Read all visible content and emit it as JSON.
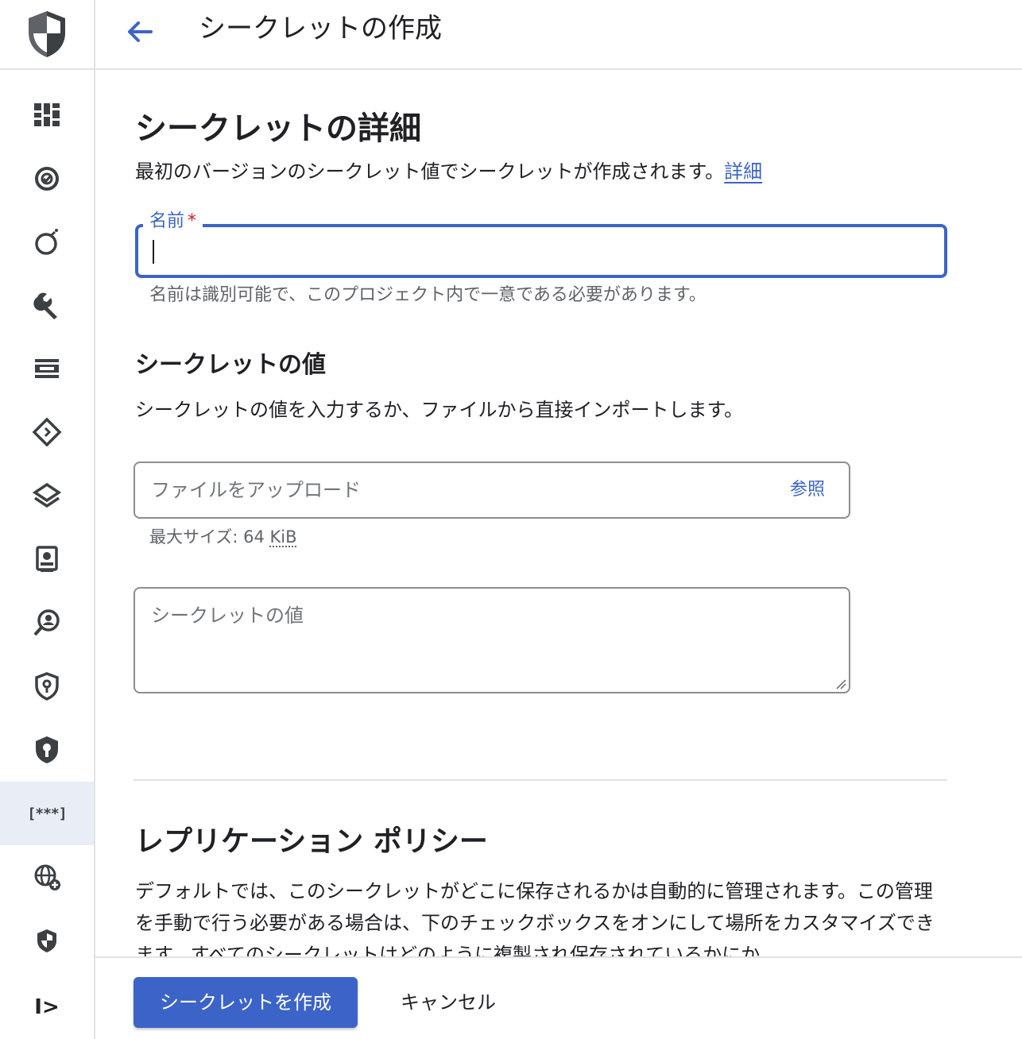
{
  "header": {
    "title": "シークレットの作成"
  },
  "sidebar": {
    "items": [
      {
        "icon": "dashboard-icon"
      },
      {
        "icon": "threat-detection-icon"
      },
      {
        "icon": "bomb-icon"
      },
      {
        "icon": "wrench-icon"
      },
      {
        "icon": "list-view-icon"
      },
      {
        "icon": "diamond-code-icon"
      },
      {
        "icon": "layers-icon"
      },
      {
        "icon": "badge-icon"
      },
      {
        "icon": "user-search-icon"
      },
      {
        "icon": "shield-key-icon"
      },
      {
        "icon": "shield-lock-icon"
      },
      {
        "icon": "secret-manager-icon",
        "glyph": "[***]",
        "active": true
      },
      {
        "icon": "globe-add-icon"
      },
      {
        "icon": "shield-icon"
      }
    ],
    "expand_glyph": "I>"
  },
  "details": {
    "title": "シークレットの詳細",
    "description": "最初のバージョンのシークレット値でシークレットが作成されます。",
    "link": "詳細",
    "name_label": "名前",
    "required_mark": "*",
    "name_value": "",
    "name_hint": "名前は識別可能で、このプロジェクト内で一意である必要があります。"
  },
  "secret_value": {
    "title": "シークレットの値",
    "description": "シークレットの値を入力するか、ファイルから直接インポートします。",
    "upload_placeholder": "ファイルをアップロード",
    "browse": "参照",
    "max_size_prefix": "最大サイズ: 64 ",
    "max_size_unit": "KiB",
    "value_placeholder": "シークレットの値"
  },
  "replication": {
    "title": "レプリケーション ポリシー",
    "description": "デフォルトでは、このシークレットがどこに保存されるかは自動的に管理されます。この管理を手動で行う必要がある場合は、下のチェックボックスをオンにして場所をカスタマイズできます。すべてのシークレットはどのように複製され保存されているかにか"
  },
  "footer": {
    "create": "シークレットを作成",
    "cancel": "キャンセル"
  },
  "colors": {
    "accent": "#3c64c8",
    "required": "#c5221f",
    "active_rail": "#e8edf6"
  }
}
